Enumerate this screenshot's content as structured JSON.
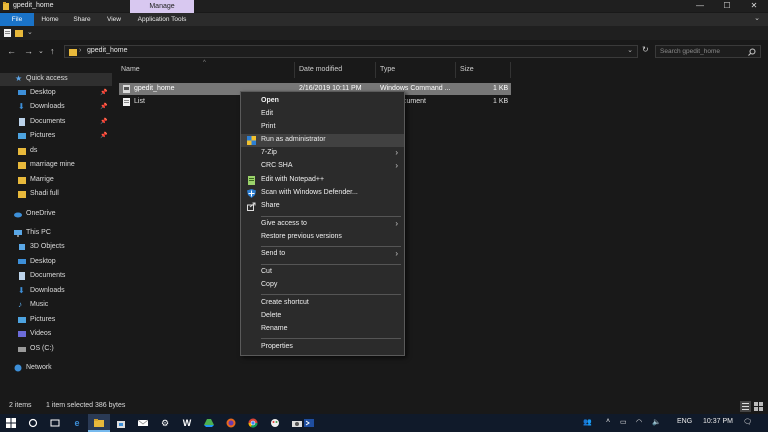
{
  "window": {
    "title": "gpedit_home",
    "manage_tab": "Manage",
    "minimize": "—",
    "maximize": "☐",
    "close": "✕"
  },
  "ribbon": {
    "tabs": [
      "File",
      "Home",
      "Share",
      "View",
      "Application Tools"
    ],
    "collapse_icon": "chevron-down-icon"
  },
  "address_bar": {
    "path": "gpedit_home",
    "search_placeholder": "Search gpedit_home"
  },
  "sidebar": {
    "items": [
      {
        "label": "Quick access",
        "icon": "star-icon",
        "pinned": false,
        "selected": true
      },
      {
        "label": "Desktop",
        "icon": "desktop-icon",
        "pinned": true
      },
      {
        "label": "Downloads",
        "icon": "download-icon",
        "pinned": true
      },
      {
        "label": "Documents",
        "icon": "documents-icon",
        "pinned": true
      },
      {
        "label": "Pictures",
        "icon": "pictures-icon",
        "pinned": true
      },
      {
        "label": "ds",
        "icon": "folder-icon",
        "pinned": false
      },
      {
        "label": "marriage mine",
        "icon": "folder-icon",
        "pinned": false
      },
      {
        "label": "Marrige",
        "icon": "folder-icon",
        "pinned": false
      },
      {
        "label": "Shadi full",
        "icon": "folder-icon",
        "pinned": false
      },
      {
        "label": "OneDrive",
        "icon": "cloud-icon",
        "pinned": false
      },
      {
        "label": "This PC",
        "icon": "computer-icon",
        "pinned": false
      },
      {
        "label": "3D Objects",
        "icon": "cube-icon",
        "pinned": false
      },
      {
        "label": "Desktop",
        "icon": "desktop-icon",
        "pinned": false
      },
      {
        "label": "Documents",
        "icon": "documents-icon",
        "pinned": false
      },
      {
        "label": "Downloads",
        "icon": "download-icon",
        "pinned": false
      },
      {
        "label": "Music",
        "icon": "music-icon",
        "pinned": false
      },
      {
        "label": "Pictures",
        "icon": "pictures-icon",
        "pinned": false
      },
      {
        "label": "Videos",
        "icon": "video-icon",
        "pinned": false
      },
      {
        "label": "OS (C:)",
        "icon": "drive-icon",
        "pinned": false
      },
      {
        "label": "Network",
        "icon": "network-icon",
        "pinned": false
      }
    ]
  },
  "file_list": {
    "columns": [
      "Name",
      "Date modified",
      "Type",
      "Size"
    ],
    "rows": [
      {
        "name": "gpedit_home",
        "date": "2/16/2019 10:11 PM",
        "type": "Windows Command ...",
        "size": "1 KB",
        "selected": true
      },
      {
        "name": "List",
        "date": "",
        "type": "cument",
        "size": "1 KB",
        "selected": false
      }
    ]
  },
  "context_menu": {
    "items": [
      {
        "label": "Open",
        "bold": true
      },
      {
        "label": "Edit"
      },
      {
        "label": "Print"
      },
      {
        "label": "Run as administrator",
        "icon": "shield-icon",
        "hover": true
      },
      {
        "label": "7-Zip",
        "submenu": true
      },
      {
        "label": "CRC SHA",
        "submenu": true
      },
      {
        "label": "Edit with Notepad++",
        "icon": "notepad-icon"
      },
      {
        "label": "Scan with Windows Defender...",
        "icon": "defender-icon"
      },
      {
        "label": "Share",
        "icon": "share-icon"
      },
      {
        "label": "Give access to",
        "submenu": true
      },
      {
        "label": "Restore previous versions"
      },
      {
        "label": "Send to",
        "submenu": true
      },
      {
        "label": "Cut"
      },
      {
        "label": "Copy"
      },
      {
        "label": "Create shortcut"
      },
      {
        "label": "Delete"
      },
      {
        "label": "Rename"
      },
      {
        "label": "Properties"
      }
    ]
  },
  "status_bar": {
    "item_count": "2 items",
    "selection": "1 item selected  386 bytes"
  },
  "taskbar": {
    "apps": [
      "windows-icon",
      "search-icon",
      "task-view-icon",
      "edge-icon",
      "explorer-icon",
      "store-icon",
      "mail-icon",
      "settings-icon",
      "drive-icon",
      "firefox-icon",
      "chrome-icon",
      "paint-icon",
      "camera-icon",
      "powershell-icon"
    ],
    "language": "ENG",
    "time": "10:37 PM"
  },
  "colors": {
    "accent": "#1a73c8",
    "manage_tab": "#d8c8f0",
    "background": "#191919"
  }
}
